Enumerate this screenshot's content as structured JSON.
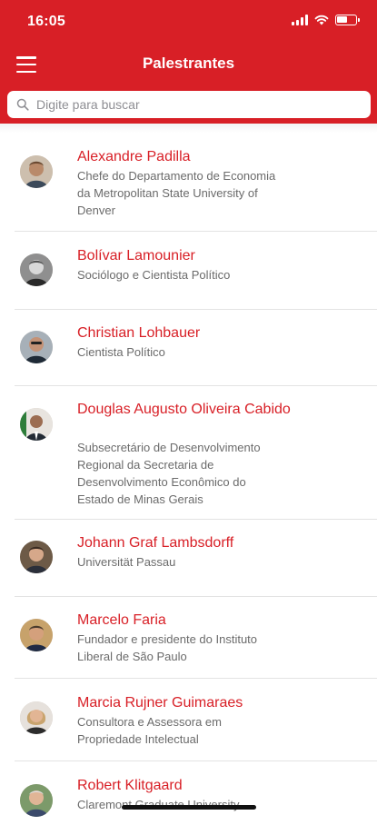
{
  "status_bar": {
    "time": "16:05"
  },
  "header": {
    "title": "Palestrantes"
  },
  "search": {
    "placeholder": "Digite para buscar"
  },
  "speakers": [
    {
      "name": "Alexandre Padilla",
      "desc_lines": [
        "Chefe do Departamento de Economia",
        "da Metropolitan State University of",
        "Denver"
      ]
    },
    {
      "name": "Bolívar Lamounier",
      "desc_lines": [
        "Sociólogo e Cientista Político"
      ]
    },
    {
      "name": "Christian Lohbauer",
      "desc_lines": [
        "Cientista Político"
      ]
    },
    {
      "name": "Douglas Augusto Oliveira Cabido",
      "desc_lines": [
        "Subsecretário de Desenvolvimento",
        "Regional da Secretaria de",
        "Desenvolvimento Econômico do",
        "Estado de Minas Gerais"
      ]
    },
    {
      "name": "Johann Graf Lambsdorff",
      "desc_lines": [
        "Universität Passau"
      ]
    },
    {
      "name": "Marcelo Faria",
      "desc_lines": [
        "Fundador e presidente do Instituto",
        "Liberal de São Paulo"
      ]
    },
    {
      "name": "Marcia Rujner Guimaraes",
      "desc_lines": [
        "Consultora e Assessora em",
        "Propriedade Intelectual"
      ]
    },
    {
      "name": "Robert Klitgaard",
      "desc_lines": [
        "Claremont Graduate University"
      ]
    }
  ],
  "colors": {
    "brand": "#d81f26",
    "text_secondary": "#6b6b6b",
    "divider": "#e3e3e3"
  }
}
